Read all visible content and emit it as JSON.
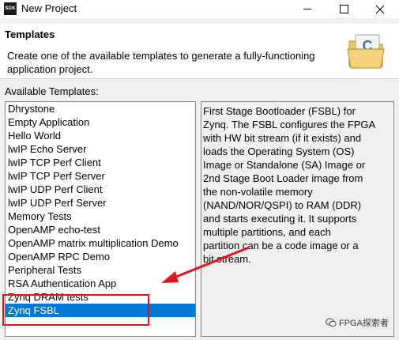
{
  "window": {
    "icon_text": "SDK",
    "title": "New Project"
  },
  "header": {
    "title": "Templates",
    "description": "Create one of the available templates to generate a fully-functioning application project."
  },
  "templates": {
    "label": "Available Templates:",
    "items": [
      "Dhrystone",
      "Empty Application",
      "Hello World",
      "lwIP Echo Server",
      "lwIP TCP Perf Client",
      "lwIP TCP Perf Server",
      "lwIP UDP Perf Client",
      "lwIP UDP Perf Server",
      "Memory Tests",
      "OpenAMP echo-test",
      "OpenAMP matrix multiplication Demo",
      "OpenAMP RPC Demo",
      "Peripheral Tests",
      "RSA Authentication App",
      "Zynq DRAM tests",
      "Zynq FSBL"
    ],
    "selected": "Zynq FSBL",
    "selection_color": "#0078d7"
  },
  "description_panel": {
    "text": "First Stage Bootloader (FSBL) for\nZynq. The FSBL configures the FPGA\nwith HW bit stream (if it exists)  and\nloads the Operating System (OS)\nImage or Standalone (SA) Image or\n2nd Stage Boot Loader image from\nthe  non-volatile memory\n(NAND/NOR/QSPI) to RAM (DDR)\nand starts executing it.  It supports\nmultiple partitions,  and each\npartition can be a code image or a\nbit stream."
  },
  "annotation": {
    "color": "#e0141e"
  },
  "watermark": {
    "text": "FPGA探索者"
  }
}
